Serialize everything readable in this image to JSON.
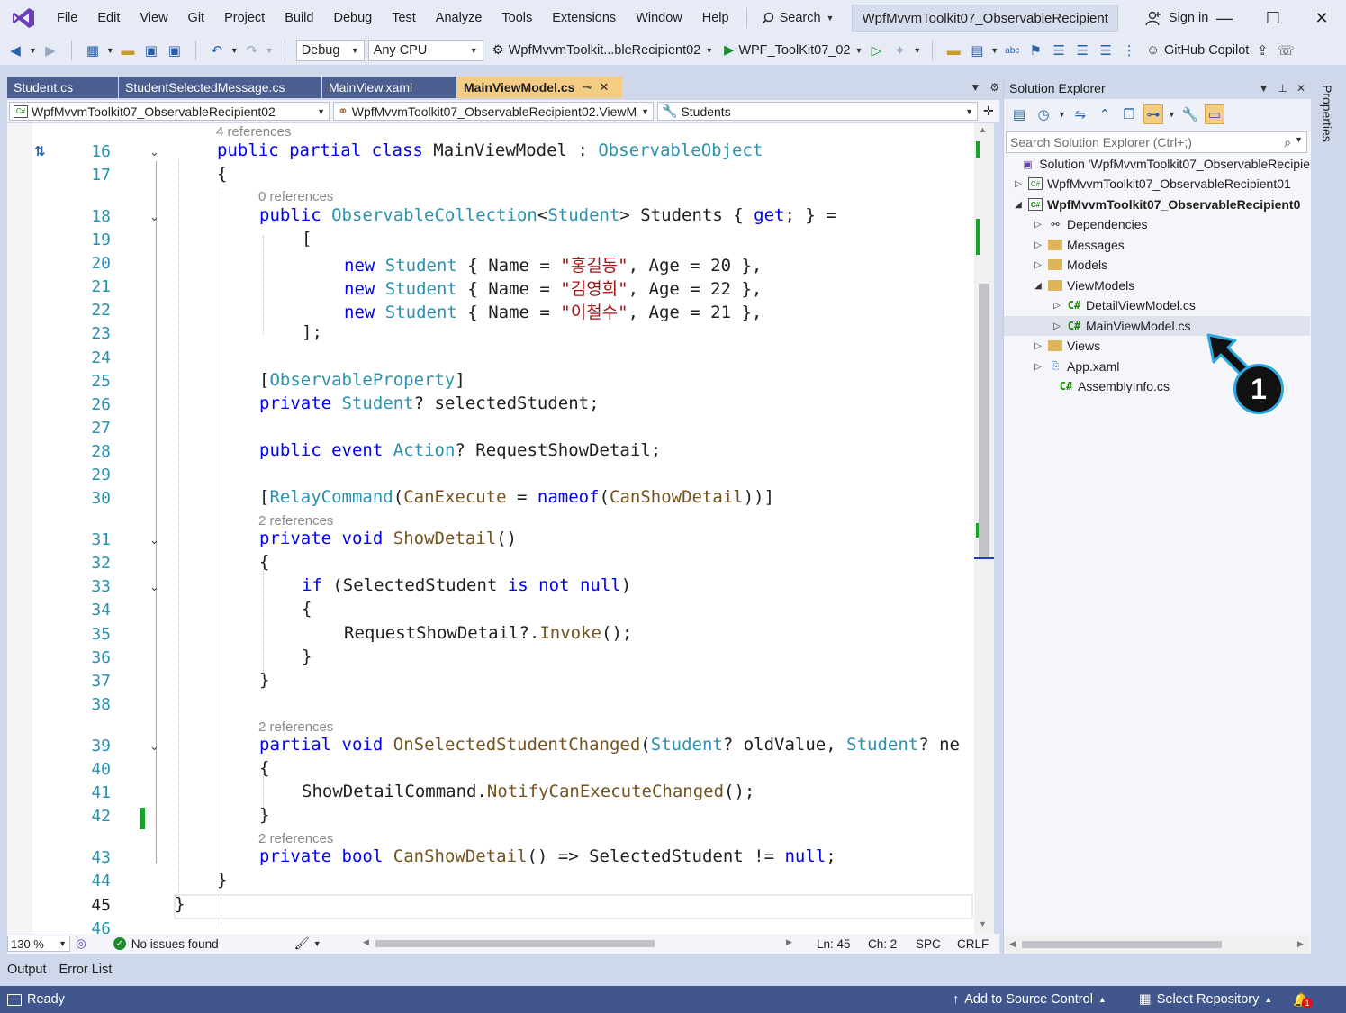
{
  "menu": [
    "File",
    "Edit",
    "View",
    "Git",
    "Project",
    "Build",
    "Debug",
    "Test",
    "Analyze",
    "Tools",
    "Extensions",
    "Window",
    "Help"
  ],
  "search_label": "Search",
  "window_title": "WpfMvvmToolkit07_ObservableRecipient",
  "signin_label": "Sign in",
  "toolbar": {
    "config": "Debug",
    "platform": "Any CPU",
    "startup_project": "WpfMvvmToolkit...bleRecipient02",
    "run_target": "WPF_ToolKit07_02",
    "copilot": "GitHub Copilot"
  },
  "editor_tabs": [
    {
      "label": "Student.cs",
      "active": false
    },
    {
      "label": "StudentSelectedMessage.cs",
      "active": false
    },
    {
      "label": "MainView.xaml",
      "active": false
    },
    {
      "label": "MainViewModel.cs",
      "active": true
    }
  ],
  "navbar": {
    "project": "WpfMvvmToolkit07_ObservableRecipient02",
    "type": "WpfMvvmToolkit07_ObservableRecipient02.ViewM",
    "member": "Students"
  },
  "codelens": {
    "l16": "4 references",
    "l18": "0 references",
    "l31": "2 references",
    "l39": "2 references",
    "l43": "2 references"
  },
  "code_lines": [
    {
      "n": "16",
      "text": "public partial class MainViewModel : ObservableObject"
    },
    {
      "n": "17",
      "text": "{"
    },
    {
      "n": "18",
      "text": "public ObservableCollection<Student> Students { get; } ="
    },
    {
      "n": "19",
      "text": "["
    },
    {
      "n": "20",
      "text": "new Student { Name = \"홍길동\", Age = 20 },"
    },
    {
      "n": "21",
      "text": "new Student { Name = \"김영희\", Age = 22 },"
    },
    {
      "n": "22",
      "text": "new Student { Name = \"이철수\", Age = 21 },"
    },
    {
      "n": "23",
      "text": "];"
    },
    {
      "n": "24",
      "text": ""
    },
    {
      "n": "25",
      "text": "[ObservableProperty]"
    },
    {
      "n": "26",
      "text": "private Student? selectedStudent;"
    },
    {
      "n": "27",
      "text": ""
    },
    {
      "n": "28",
      "text": "public event Action? RequestShowDetail;"
    },
    {
      "n": "29",
      "text": ""
    },
    {
      "n": "30",
      "text": "[RelayCommand(CanExecute = nameof(CanShowDetail))]"
    },
    {
      "n": "31",
      "text": "private void ShowDetail()"
    },
    {
      "n": "32",
      "text": "{"
    },
    {
      "n": "33",
      "text": "if (SelectedStudent is not null)"
    },
    {
      "n": "34",
      "text": "{"
    },
    {
      "n": "35",
      "text": "RequestShowDetail?.Invoke();"
    },
    {
      "n": "36",
      "text": "}"
    },
    {
      "n": "37",
      "text": "}"
    },
    {
      "n": "38",
      "text": ""
    },
    {
      "n": "39",
      "text": "partial void OnSelectedStudentChanged(Student? oldValue, Student? ne"
    },
    {
      "n": "40",
      "text": "{"
    },
    {
      "n": "41",
      "text": "ShowDetailCommand.NotifyCanExecuteChanged();"
    },
    {
      "n": "42",
      "text": "}"
    },
    {
      "n": "43",
      "text": "private bool CanShowDetail() => SelectedStudent != null;"
    },
    {
      "n": "44",
      "text": "}"
    },
    {
      "n": "45",
      "text": "}"
    },
    {
      "n": "46",
      "text": ""
    }
  ],
  "editor_status": {
    "zoom": "130 %",
    "issues": "No issues found",
    "line": "Ln: 45",
    "col": "Ch: 2",
    "indent": "SPC",
    "eol": "CRLF"
  },
  "bottom_tabs": [
    "Output",
    "Error List"
  ],
  "statusbar": {
    "ready": "Ready",
    "source_control": "Add to Source Control",
    "repository": "Select Repository",
    "notifications": "1"
  },
  "solution_explorer": {
    "title": "Solution Explorer",
    "search_placeholder": "Search Solution Explorer (Ctrl+;)",
    "items": [
      {
        "label": "Solution 'WpfMvvmToolkit07_ObservableRecipie",
        "kind": "solution"
      },
      {
        "label": "WpfMvvmToolkit07_ObservableRecipient01",
        "kind": "project"
      },
      {
        "label": "WpfMvvmToolkit07_ObservableRecipient0",
        "kind": "project"
      },
      {
        "label": "Dependencies",
        "kind": "dependencies"
      },
      {
        "label": "Messages",
        "kind": "folder"
      },
      {
        "label": "Models",
        "kind": "folder"
      },
      {
        "label": "ViewModels",
        "kind": "folder"
      },
      {
        "label": "DetailViewModel.cs",
        "kind": "cs"
      },
      {
        "label": "MainViewModel.cs",
        "kind": "cs"
      },
      {
        "label": "Views",
        "kind": "folder"
      },
      {
        "label": "App.xaml",
        "kind": "xaml"
      },
      {
        "label": "AssemblyInfo.cs",
        "kind": "cs"
      }
    ]
  },
  "properties_tab": "Properties",
  "callout_number": "1"
}
